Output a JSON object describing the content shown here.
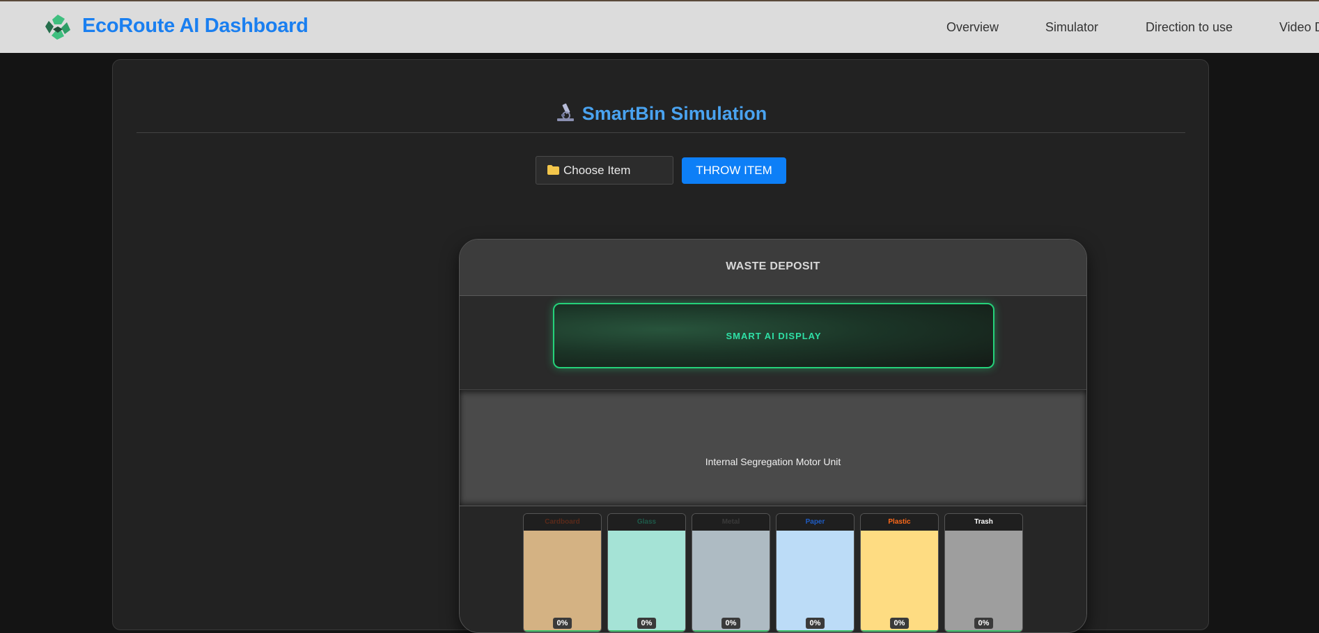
{
  "app": {
    "title": "EcoRoute AI Dashboard",
    "logo_icon": "recycle-icon"
  },
  "nav": {
    "items": [
      {
        "label": "Overview"
      },
      {
        "label": "Simulator"
      },
      {
        "label": "Direction to use"
      },
      {
        "label": "Video D"
      }
    ]
  },
  "simulation": {
    "icon": "microscope-icon",
    "title": "SmartBin Simulation",
    "choose_item": "Choose Item",
    "choose_icon": "folder-icon",
    "throw_button": "THROW ITEM"
  },
  "bin": {
    "deposit_label": "WASTE DEPOSIT",
    "display_label": "SMART AI DISPLAY",
    "motor_label": "Internal Segregation Motor Unit",
    "compartments": [
      {
        "label": "Cardboard",
        "percent": "0%",
        "fill_color": "#d4b283",
        "label_color": "#5a2a1a"
      },
      {
        "label": "Glass",
        "percent": "0%",
        "fill_color": "#a5e3d6",
        "label_color": "#1e5a4a"
      },
      {
        "label": "Metal",
        "percent": "0%",
        "fill_color": "#aebbc3",
        "label_color": "#3a3a3a"
      },
      {
        "label": "Paper",
        "percent": "0%",
        "fill_color": "#bcdcf7",
        "label_color": "#1f5cc4"
      },
      {
        "label": "Plastic",
        "percent": "0%",
        "fill_color": "#fedc82",
        "label_color": "#ff6a1a"
      },
      {
        "label": "Trash",
        "percent": "0%",
        "fill_color": "#9e9e9e",
        "label_color": "#ffffff"
      }
    ]
  },
  "colors": {
    "brand": "#1a7ff0",
    "title_accent": "#4aa3f0",
    "primary_button": "#0d7ff7",
    "display_border": "#25d27a",
    "display_text": "#2fe0a6"
  }
}
